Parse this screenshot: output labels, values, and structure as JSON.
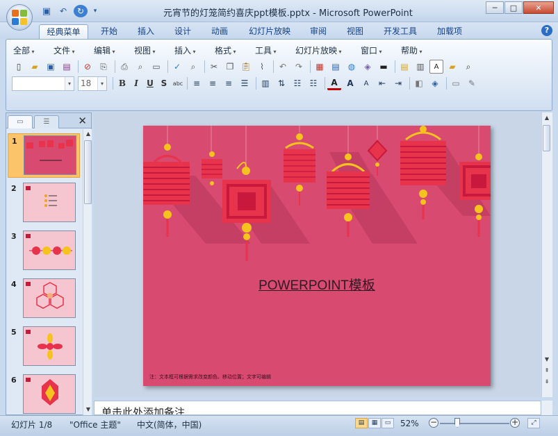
{
  "window": {
    "title": "元宵节的灯笼简约喜庆ppt模板.pptx - Microsoft PowerPoint",
    "minimize": "─",
    "maximize": "□",
    "close": "✕"
  },
  "quick_access": {
    "save_icon": "save-icon",
    "undo_icon": "undo-icon",
    "redo_icon": "redo-icon",
    "customize": "▾"
  },
  "tabs": [
    "经典菜单",
    "开始",
    "插入",
    "设计",
    "动画",
    "幻灯片放映",
    "审阅",
    "视图",
    "开发工具",
    "加载项"
  ],
  "help": "?",
  "menus": [
    "全部",
    "文件",
    "编辑",
    "视图",
    "插入",
    "格式",
    "工具",
    "幻灯片放映",
    "窗口",
    "帮助"
  ],
  "font": {
    "name": "",
    "size": "18"
  },
  "format_buttons": {
    "bold": "B",
    "italic": "I",
    "underline": "U",
    "shadow": "S",
    "strike": "abc"
  },
  "left_pane": {
    "close": "✕",
    "slides": [
      {
        "num": "1",
        "selected": true
      },
      {
        "num": "2",
        "selected": false
      },
      {
        "num": "3",
        "selected": false
      },
      {
        "num": "4",
        "selected": false
      },
      {
        "num": "5",
        "selected": false
      },
      {
        "num": "6",
        "selected": false
      }
    ]
  },
  "slide": {
    "title": "POWERPOINT模板",
    "note": "注：文本框可根据需求改变颜色、移动位置；文字可编辑",
    "background": "#d94a70",
    "lantern_color": "#e8334c",
    "knot_color": "#f6c21d"
  },
  "notes": {
    "placeholder": "单击此处添加备注"
  },
  "status": {
    "slide_info": "幻灯片 1/8",
    "theme": "\"Office 主题\"",
    "language": "中文(简体，中国)",
    "zoom": "52%",
    "zoom_level": 0.52
  }
}
